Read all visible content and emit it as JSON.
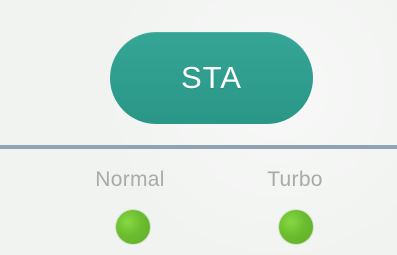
{
  "panel": {
    "colors": {
      "background": "#f1f3f1",
      "button": "#2f9f8f",
      "divider": "#90a3b4",
      "label": "#a8aba8",
      "indicator": "#6cbc2f"
    }
  },
  "start_button": {
    "label": "STA"
  },
  "modes": [
    {
      "label": "Normal",
      "indicator_icon": "green-led-icon",
      "indicator_on": true
    },
    {
      "label": "Turbo",
      "indicator_icon": "green-led-icon",
      "indicator_on": true
    }
  ]
}
